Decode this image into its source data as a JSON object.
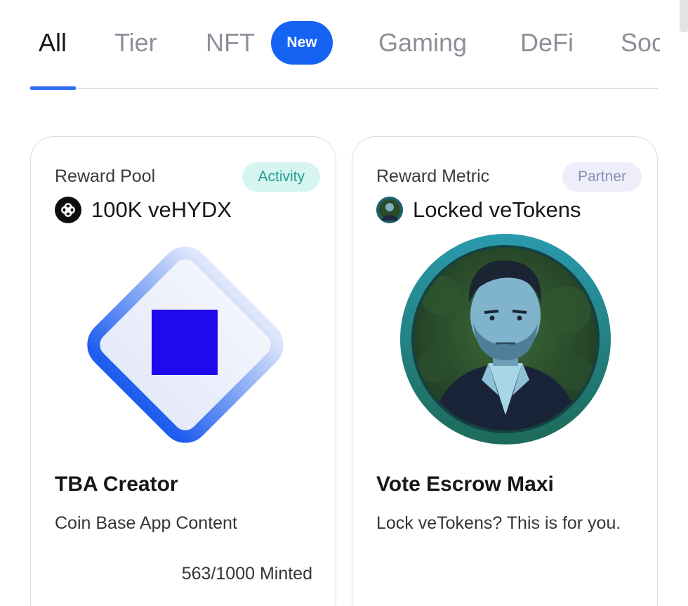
{
  "tabs": [
    {
      "label": "All",
      "active": true
    },
    {
      "label": "Tier",
      "active": false
    },
    {
      "label": "NFT",
      "active": false,
      "badge": "New"
    },
    {
      "label": "Gaming",
      "active": false
    },
    {
      "label": "DeFi",
      "active": false
    },
    {
      "label": "Soc",
      "active": false
    }
  ],
  "colors": {
    "accent": "#1463f3",
    "activity_pill_bg": "#d6f5f1",
    "activity_pill_text": "#1f9b8f",
    "partner_pill_bg": "#edeefa",
    "partner_pill_text": "#8a8fb3"
  },
  "cards": [
    {
      "reward_label": "Reward Pool",
      "tag": "Activity",
      "reward_icon": "hydx-logo-icon",
      "reward_value": "100K veHYDX",
      "art": "blue-diamond-square",
      "title": "TBA Creator",
      "description": "Coin Base App Content",
      "minted": "563/1000 Minted"
    },
    {
      "reward_label": "Reward Metric",
      "tag": "Partner",
      "reward_icon": "avatar-portrait-icon",
      "reward_value": "Locked veTokens",
      "art": "portrait-medallion",
      "title": "Vote Escrow Maxi",
      "description": "Lock veTokens? This is for you."
    }
  ]
}
